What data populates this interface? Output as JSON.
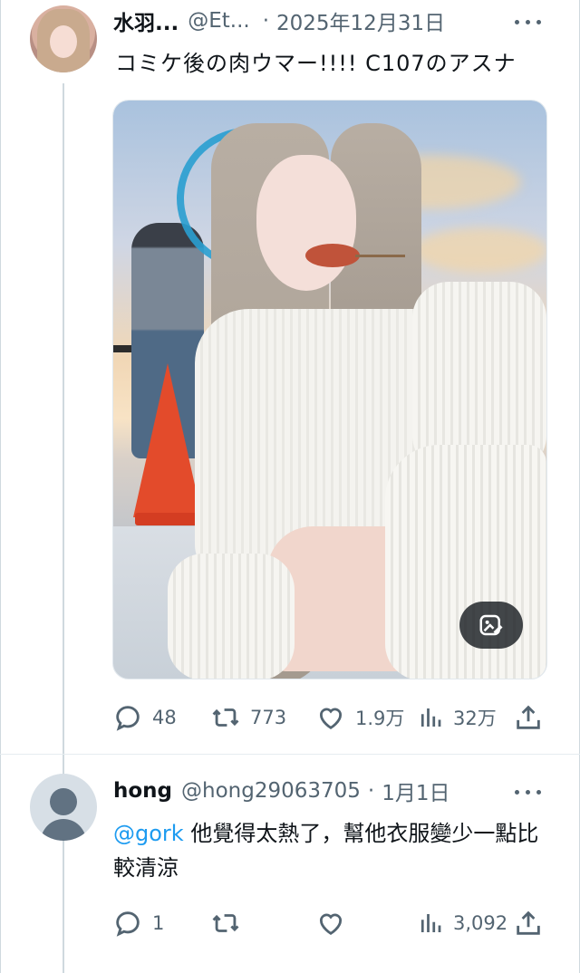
{
  "tweet": {
    "display_name": "水羽...",
    "handle": "@Et...",
    "separator": "·",
    "date": "2025年12月31日",
    "text": "コミケ後の肉ウマー!!!! C107のアスナ",
    "stats": {
      "replies": "48",
      "reposts": "773",
      "likes": "1.9万",
      "views": "32万"
    }
  },
  "reply": {
    "display_name": "hong",
    "handle": "@hong29063705",
    "separator": "·",
    "date": "1月1日",
    "mention": "@gork",
    "text": " 他覺得太熱了，幫他衣服變少一點比較清涼",
    "stats": {
      "replies": "1",
      "views": "3,092"
    }
  },
  "colors": {
    "accent": "#1d9bf0",
    "secondary_text": "#536471",
    "primary_text": "#0f1419"
  },
  "icons": [
    "more-icon",
    "reply-icon",
    "repost-icon",
    "like-icon",
    "views-icon",
    "share-icon",
    "media-edit-icon"
  ]
}
